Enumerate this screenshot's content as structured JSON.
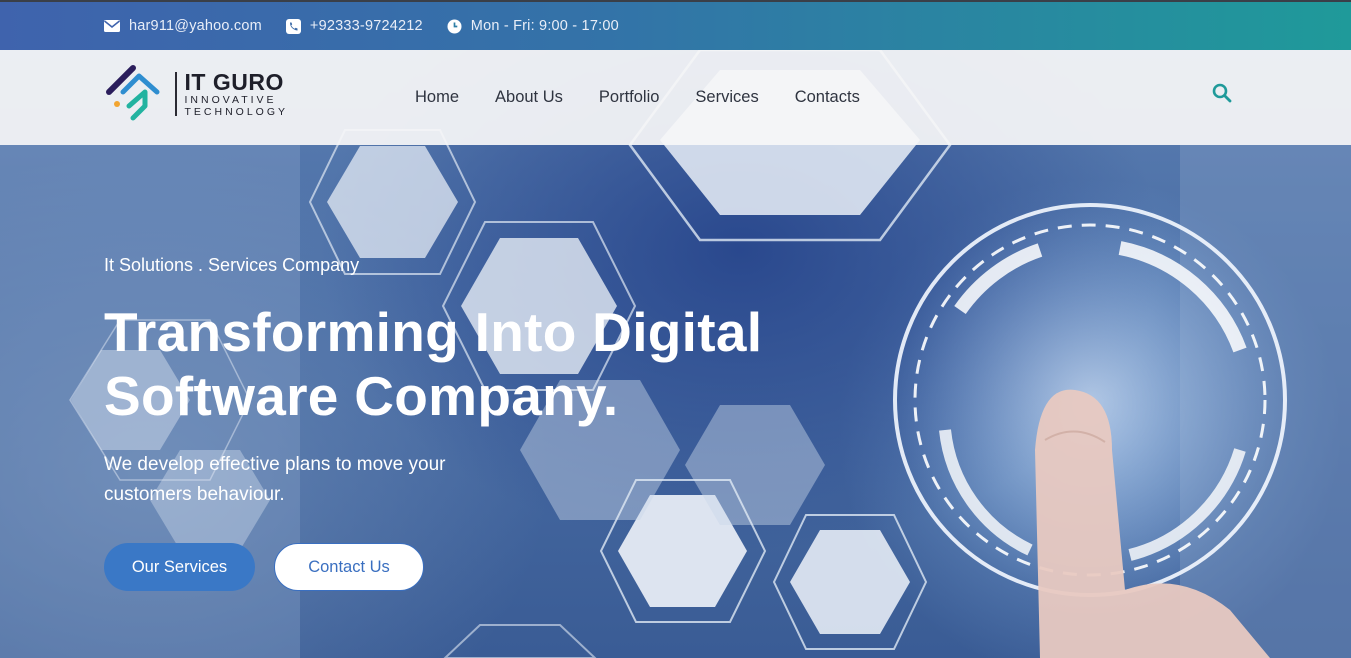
{
  "topbar": {
    "email": "har911@yahoo.com",
    "phone": "+92333-9724212",
    "hours": "Mon - Fri: 9:00 - 17:00",
    "icons": [
      "envelope-icon",
      "phone-icon",
      "clock-icon"
    ]
  },
  "header": {
    "brand": "IT GURO",
    "tagline_line1": "INNOVATIVE",
    "tagline_line2": "TECHNOLOGY",
    "nav": [
      "Home",
      "About Us",
      "Portfolio",
      "Services",
      "Contacts"
    ],
    "search_icon": "search-icon"
  },
  "hero": {
    "eyebrow": "It Solutions . Services Company",
    "headline_line1": "Transforming Into Digital",
    "headline_line2": "Software Company.",
    "subtext_line1": "We develop effective plans to move your",
    "subtext_line2": "customers behaviour.",
    "primary_button": "Our Services",
    "secondary_button": "Contact Us"
  },
  "colors": {
    "topbar_start": "#3f63ad",
    "topbar_end": "#1f9a9a",
    "accent_blue": "#3a78c6",
    "accent_teal": "#1f9a9a"
  }
}
